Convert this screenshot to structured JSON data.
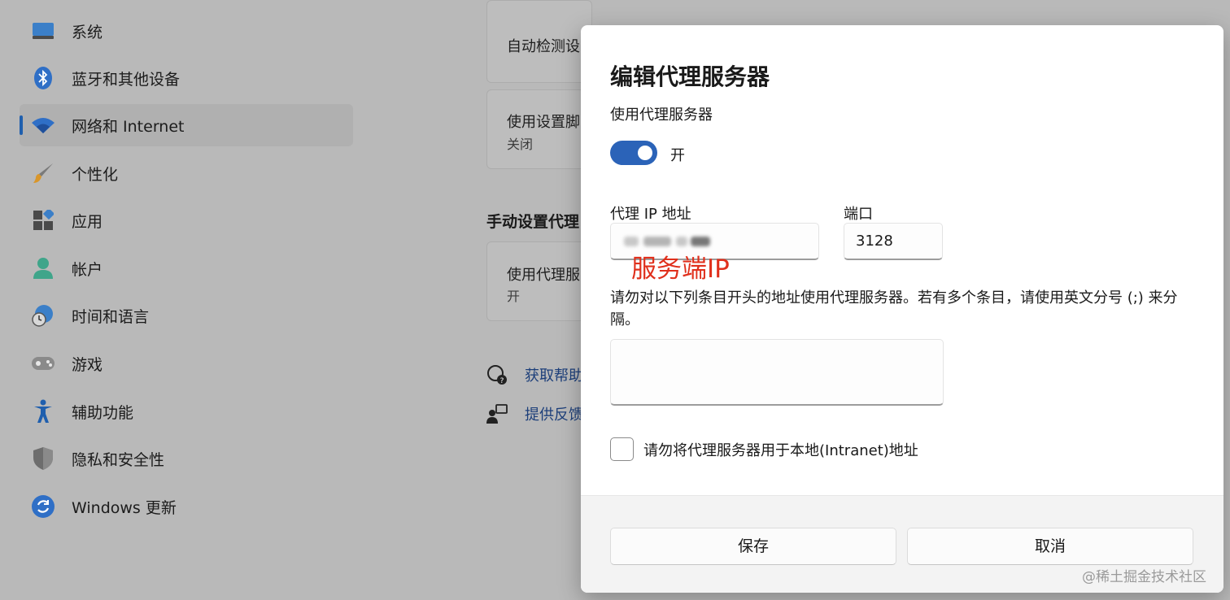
{
  "sidebar": {
    "items": [
      {
        "label": "系统",
        "icon": "system-icon"
      },
      {
        "label": "蓝牙和其他设备",
        "icon": "bluetooth-icon"
      },
      {
        "label": "网络和 Internet",
        "icon": "wifi-icon",
        "active": true
      },
      {
        "label": "个性化",
        "icon": "brush-icon"
      },
      {
        "label": "应用",
        "icon": "apps-icon"
      },
      {
        "label": "帐户",
        "icon": "account-icon"
      },
      {
        "label": "时间和语言",
        "icon": "globe-clock-icon"
      },
      {
        "label": "游戏",
        "icon": "gamepad-icon"
      },
      {
        "label": "辅助功能",
        "icon": "accessibility-icon"
      },
      {
        "label": "隐私和安全性",
        "icon": "shield-icon"
      },
      {
        "label": "Windows 更新",
        "icon": "update-icon"
      }
    ]
  },
  "content": {
    "card_auto_detect": {
      "title": "自动检测设"
    },
    "card_script": {
      "title": "使用设置脚",
      "status": "关闭"
    },
    "manual_heading": "手动设置代理",
    "card_manual": {
      "title": "使用代理服",
      "status": "开"
    },
    "help_link": "获取帮助",
    "feedback_link": "提供反馈"
  },
  "dialog": {
    "title": "编辑代理服务器",
    "use_proxy_label": "使用代理服务器",
    "toggle_state": "开",
    "toggle_on": true,
    "ip_label": "代理 IP 地址",
    "ip_value_redacted": true,
    "port_label": "端口",
    "port_value": "3128",
    "annotation": "服务端IP",
    "exceptions_desc": "请勿对以下列条目开头的地址使用代理服务器。若有多个条目，请使用英文分号 (;) 来分隔。",
    "exceptions_value": "",
    "local_checkbox_label": "请勿将代理服务器用于本地(Intranet)地址",
    "local_checked": false,
    "save_label": "保存",
    "cancel_label": "取消"
  },
  "watermark": "@稀土掘金技术社区",
  "colors": {
    "accent": "#2b63b8",
    "annotation_red": "#e0301c",
    "link": "#1d3f7a"
  }
}
